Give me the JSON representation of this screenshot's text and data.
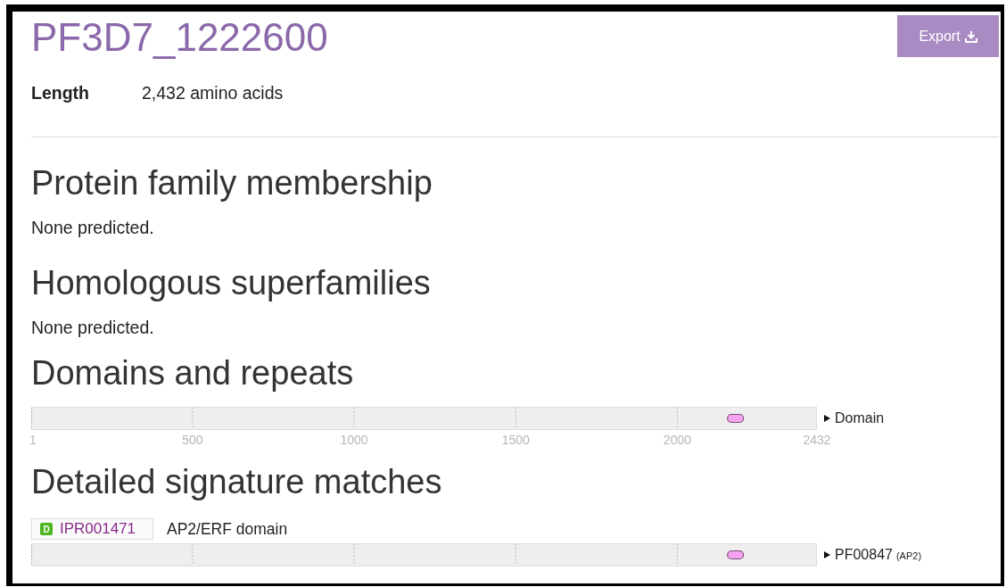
{
  "header": {
    "title": "PF3D7_1222600",
    "export_button": "Export"
  },
  "length": {
    "label": "Length",
    "value": "2,432 amino acids"
  },
  "sections": [
    {
      "heading": "Protein family membership",
      "kind": "text",
      "text": "None predicted."
    },
    {
      "heading": "Homologous superfamilies",
      "kind": "text",
      "text": "None predicted."
    },
    {
      "heading": "Domains and repeats",
      "kind": "track",
      "track": {
        "label": "Domain",
        "axis_ticks": [
          "1",
          "500",
          "1000",
          "1500",
          "2000",
          "2432"
        ]
      }
    },
    {
      "heading": "Detailed signature matches",
      "kind": "matches",
      "matches": [
        {
          "type_badge": "D",
          "accession": "IPR001471",
          "name": "AP2/ERF domain",
          "track": {
            "label": "PF00847",
            "sublabel": "(AP2)"
          }
        }
      ]
    }
  ]
}
